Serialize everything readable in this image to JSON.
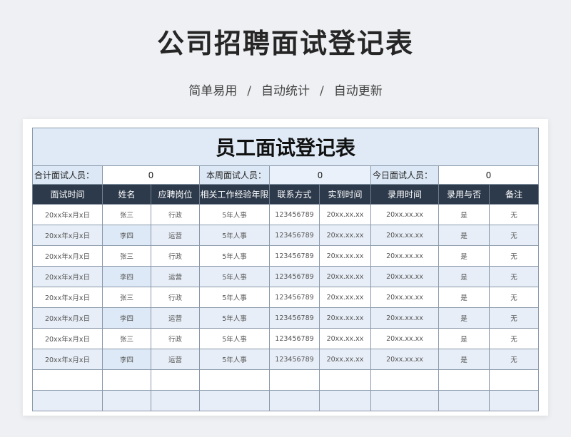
{
  "page": {
    "title": "公司招聘面试登记表",
    "subtitle_items": [
      "简单易用",
      "自动统计",
      "自动更新"
    ],
    "separator": "/"
  },
  "sheet": {
    "banner_title": "员工面试登记表",
    "summary": [
      {
        "label": "合计面试人员：",
        "value": "0"
      },
      {
        "label": "本周面试人员：",
        "value": "0"
      },
      {
        "label": "今日面试人员：",
        "value": "0"
      }
    ],
    "columns": [
      "面试时间",
      "姓名",
      "应聘岗位",
      "相关工作经验年限",
      "联系方式",
      "实到时间",
      "录用时间",
      "录用与否",
      "备注"
    ],
    "rows": [
      [
        "20xx年x月x日",
        "张三",
        "行政",
        "5年人事",
        "123456789",
        "20xx.xx.xx",
        "20xx.xx.xx",
        "是",
        "无"
      ],
      [
        "20xx年x月x日",
        "李四",
        "运营",
        "5年人事",
        "123456789",
        "20xx.xx.xx",
        "20xx.xx.xx",
        "是",
        "无"
      ],
      [
        "20xx年x月x日",
        "张三",
        "行政",
        "5年人事",
        "123456789",
        "20xx.xx.xx",
        "20xx.xx.xx",
        "是",
        "无"
      ],
      [
        "20xx年x月x日",
        "李四",
        "运营",
        "5年人事",
        "123456789",
        "20xx.xx.xx",
        "20xx.xx.xx",
        "是",
        "无"
      ],
      [
        "20xx年x月x日",
        "张三",
        "行政",
        "5年人事",
        "123456789",
        "20xx.xx.xx",
        "20xx.xx.xx",
        "是",
        "无"
      ],
      [
        "20xx年x月x日",
        "李四",
        "运营",
        "5年人事",
        "123456789",
        "20xx.xx.xx",
        "20xx.xx.xx",
        "是",
        "无"
      ],
      [
        "20xx年x月x日",
        "张三",
        "行政",
        "5年人事",
        "123456789",
        "20xx.xx.xx",
        "20xx.xx.xx",
        "是",
        "无"
      ],
      [
        "20xx年x月x日",
        "李四",
        "运营",
        "5年人事",
        "123456789",
        "20xx.xx.xx",
        "20xx.xx.xx",
        "是",
        "无"
      ]
    ],
    "empty_rows": 2
  },
  "colors": {
    "header_bg": "#2d3a4b",
    "banner_bg": "#dfeaf6",
    "alt_row_bg": "#e7eef7",
    "page_bg": "#eef0f3"
  }
}
